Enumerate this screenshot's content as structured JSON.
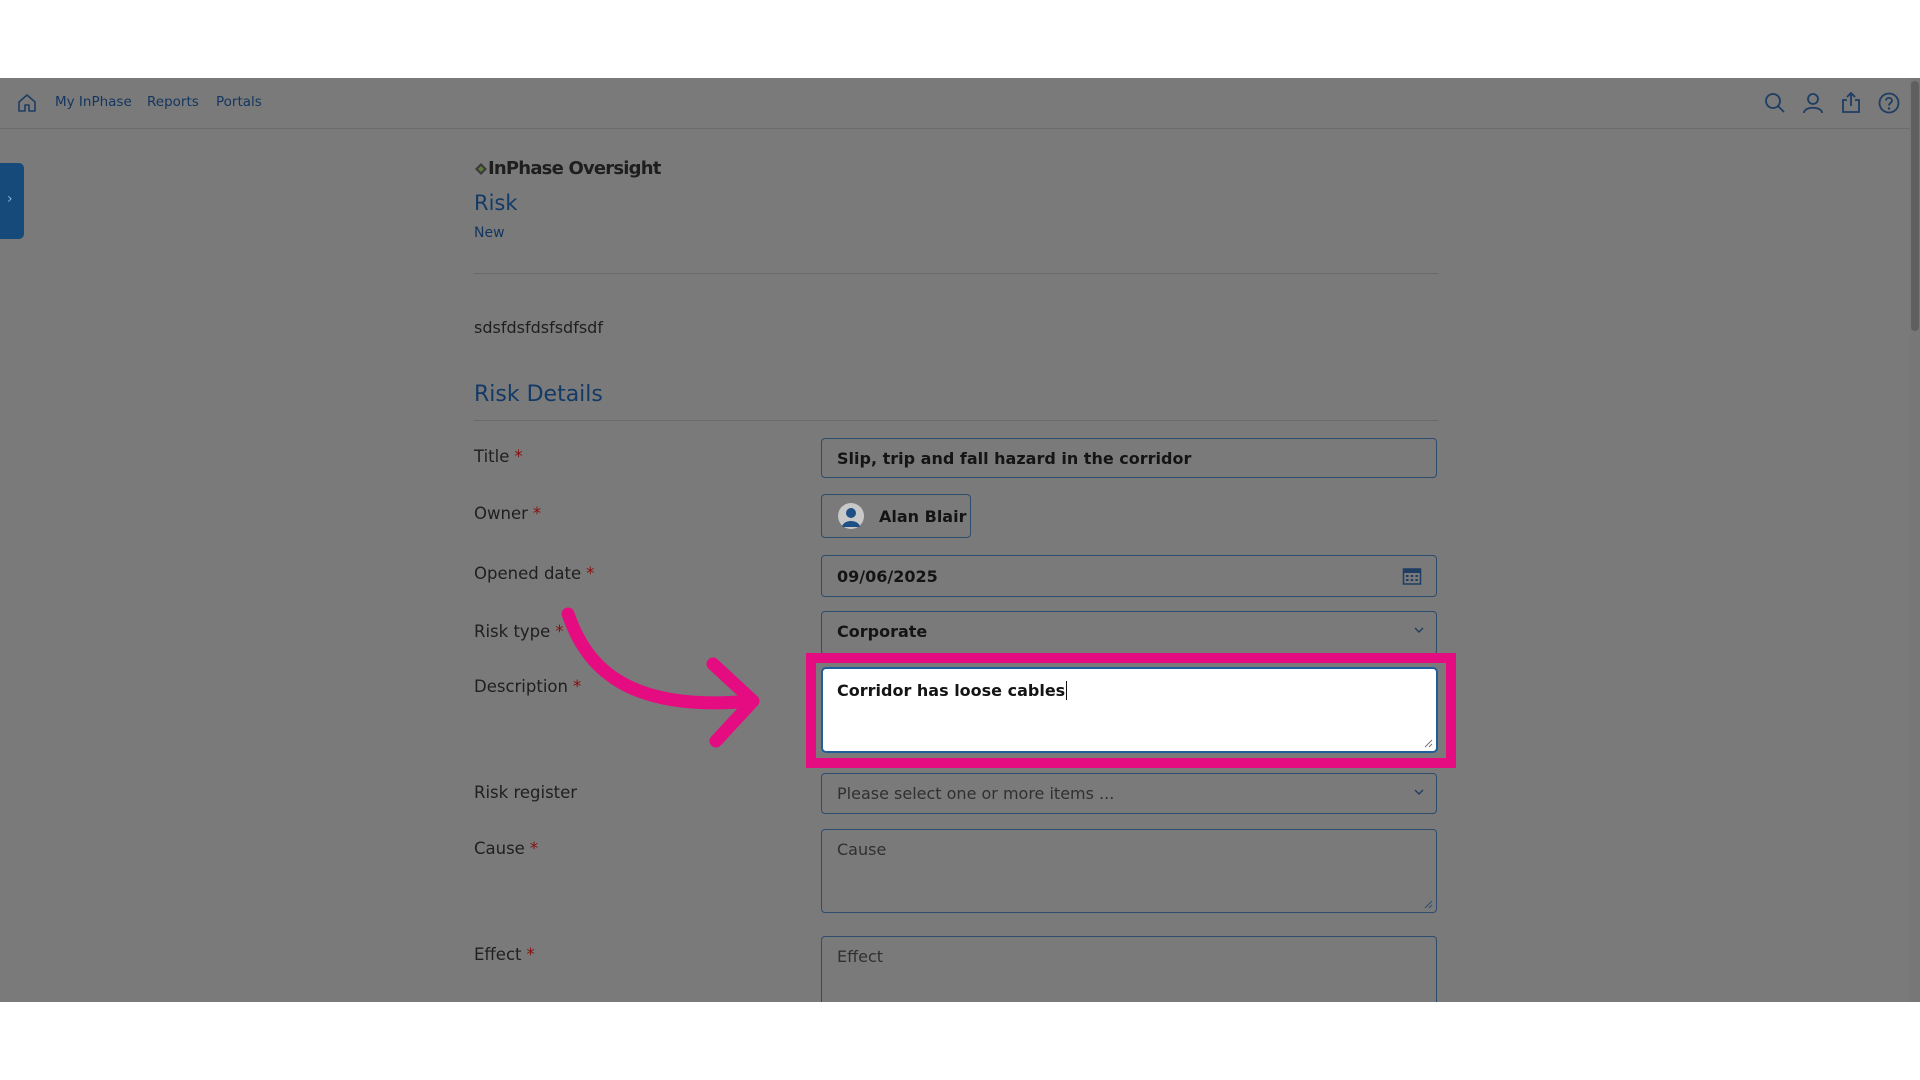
{
  "nav": {
    "home_icon": "home-icon",
    "links": [
      "My InPhase",
      "Reports",
      "Portals"
    ],
    "right_icons": [
      "search-icon",
      "user-icon",
      "share-icon",
      "help-icon"
    ]
  },
  "logo": {
    "text": "InPhase Oversight"
  },
  "page": {
    "title": "Risk",
    "subtitle": "New"
  },
  "record_text": "sdsfdsfdsfsdfsdf",
  "section": {
    "title": "Risk Details"
  },
  "form": {
    "title": {
      "label": "Title",
      "value": "Slip, trip and fall hazard in the corridor"
    },
    "owner": {
      "label": "Owner",
      "value": "Alan Blair"
    },
    "opened_date": {
      "label": "Opened date",
      "value": "09/06/2025"
    },
    "risk_type": {
      "label": "Risk type",
      "value": "Corporate"
    },
    "description": {
      "label": "Description",
      "value": "Corridor has loose cables"
    },
    "risk_register": {
      "label": "Risk register",
      "placeholder": "Please select one or more items ..."
    },
    "cause": {
      "label": "Cause",
      "placeholder": "Cause"
    },
    "effect": {
      "label": "Effect",
      "placeholder": "Effect"
    }
  },
  "colors": {
    "overlay": "#7a7a7a",
    "highlight": "#e40c80",
    "accent": "#133a66",
    "required": "#8a0d0d"
  }
}
